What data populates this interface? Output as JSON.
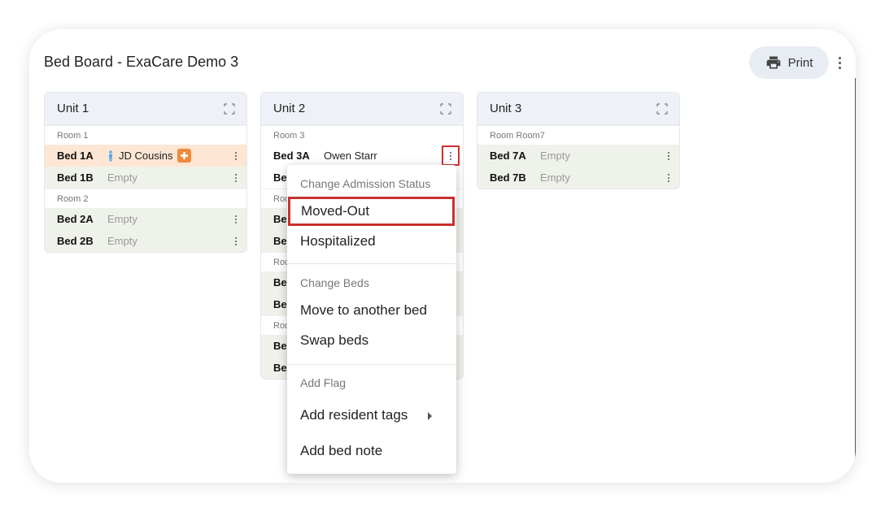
{
  "page": {
    "title": "Bed Board - ExaCare Demo 3",
    "print_label": "Print"
  },
  "units": [
    {
      "title": "Unit 1",
      "rooms": [
        {
          "label": "Room 1",
          "beds": [
            {
              "name": "Bed 1A",
              "occupant": "JD Cousins",
              "status": "occupied-alert"
            },
            {
              "name": "Bed 1B",
              "occupant": "Empty",
              "status": "empty"
            }
          ]
        },
        {
          "label": "Room 2",
          "beds": [
            {
              "name": "Bed 2A",
              "occupant": "Empty",
              "status": "empty"
            },
            {
              "name": "Bed 2B",
              "occupant": "Empty",
              "status": "empty"
            }
          ]
        }
      ]
    },
    {
      "title": "Unit 2",
      "rooms": [
        {
          "label": "Room 3",
          "beds": [
            {
              "name": "Bed 3A",
              "occupant": "Owen Starr",
              "status": "occupied"
            },
            {
              "name": "Be",
              "occupant": "",
              "status": "empty"
            }
          ]
        },
        {
          "label": "Roo",
          "beds": [
            {
              "name": "Be",
              "occupant": "",
              "status": "empty"
            },
            {
              "name": "Be",
              "occupant": "",
              "status": "empty"
            }
          ]
        },
        {
          "label": "Roo",
          "beds": [
            {
              "name": "Be",
              "occupant": "",
              "status": "empty"
            },
            {
              "name": "Be",
              "occupant": "",
              "status": "empty"
            }
          ]
        },
        {
          "label": "Roo",
          "beds": [
            {
              "name": "Be",
              "occupant": "",
              "status": "empty"
            },
            {
              "name": "Be",
              "occupant": "",
              "status": "empty"
            }
          ]
        }
      ]
    },
    {
      "title": "Unit 3",
      "rooms": [
        {
          "label": "Room Room7",
          "beds": [
            {
              "name": "Bed 7A",
              "occupant": "Empty",
              "status": "empty"
            },
            {
              "name": "Bed 7B",
              "occupant": "Empty",
              "status": "empty"
            }
          ]
        }
      ]
    }
  ],
  "context_menu": {
    "section_admission": "Change Admission Status",
    "moved_out": "Moved-Out",
    "hospitalized": "Hospitalized",
    "section_beds": "Change Beds",
    "move_bed": "Move to another bed",
    "swap_beds": "Swap beds",
    "section_flag": "Add Flag",
    "resident_tags": "Add resident tags",
    "bed_note": "Add bed note"
  },
  "colors": {
    "accent_highlight": "#c8302e",
    "empty_row": "#eef2ea",
    "alert_row": "#fde6d3",
    "alert_badge": "#f08a3c",
    "person_icon": "#5aa9e6"
  },
  "icons": {
    "print": "printer-icon",
    "expand": "expand-icon",
    "kebab": "more-vert-icon",
    "person": "person-icon",
    "plus": "plus-badge-icon",
    "submenu": "caret-right-icon"
  }
}
